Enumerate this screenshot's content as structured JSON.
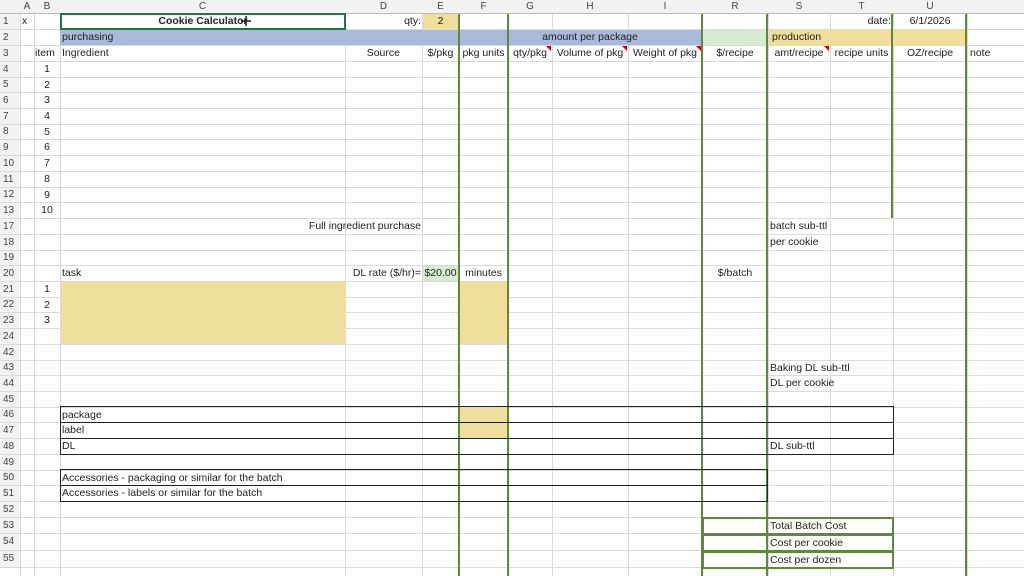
{
  "columns": [
    "A",
    "B",
    "C",
    "D",
    "E",
    "F",
    "G",
    "H",
    "I",
    "R",
    "S",
    "T",
    "U"
  ],
  "rows": [
    "1",
    "2",
    "3",
    "4",
    "5",
    "6",
    "7",
    "8",
    "9",
    "10",
    "11",
    "12",
    "13",
    "17",
    "18",
    "19",
    "20",
    "21",
    "22",
    "23",
    "24",
    "42",
    "43",
    "44",
    "45",
    "46",
    "47",
    "48",
    "49",
    "50",
    "51",
    "52",
    "53",
    "54",
    "55"
  ],
  "row1": {
    "x": "x",
    "title": "Cookie Calculator",
    "qty_label": "qty:",
    "qty_value": "2",
    "date_label": "date:",
    "date_value": "6/1/2026"
  },
  "row2": {
    "purchasing": "purchasing",
    "amount_per_package": "amount per package",
    "production": "production"
  },
  "row3": {
    "item": "item",
    "ingredient": "Ingredient",
    "source": "Source",
    "price_pkg": "$/pkg",
    "pkg_units": "pkg units",
    "qty_pkg": "qty/pkg",
    "volume_pkg": "Volume of pkg",
    "weight_pkg": "Weight of pkg",
    "price_recipe": "$/recipe",
    "amt_recipe": "amt/recipe",
    "recipe_units": "recipe units",
    "oz_recipe": "OZ/recipe",
    "note": "note"
  },
  "items": [
    "1",
    "2",
    "3",
    "4",
    "5",
    "6",
    "7",
    "8",
    "9",
    "10"
  ],
  "row17": {
    "full_purchase": "Full ingredient purchase",
    "batch_subttl": "batch sub-ttl"
  },
  "row18": {
    "per_cookie": "per cookie"
  },
  "row20": {
    "task": "task",
    "dl_rate_label": "DL rate ($/hr)=",
    "dl_rate_value": "$20.00",
    "minutes": "minutes",
    "per_batch": "$/batch"
  },
  "tasks": [
    "1",
    "2",
    "3"
  ],
  "row43": {
    "baking_dl": "Baking DL sub-ttl"
  },
  "row44": {
    "dl_per_cookie": "DL per cookie"
  },
  "row46": {
    "package": "package"
  },
  "row47": {
    "label": "label"
  },
  "row48": {
    "dl": "DL",
    "dl_subttl": "DL sub-ttl"
  },
  "row50": {
    "acc_pkg": "Accessories - packaging or similar for the batch"
  },
  "row51": {
    "acc_labels": "Accessories - labels or similar for the batch"
  },
  "row53": {
    "total_batch": "Total Batch Cost"
  },
  "row54": {
    "cost_cookie": "Cost per cookie"
  },
  "row55": {
    "cost_dozen": "Cost per dozen"
  },
  "colors": {
    "blue_fill": "#a9b9d9",
    "yellow_fill": "#f0df9c",
    "green_border": "#5a8a3a",
    "green_fill": "#d9ead3"
  }
}
